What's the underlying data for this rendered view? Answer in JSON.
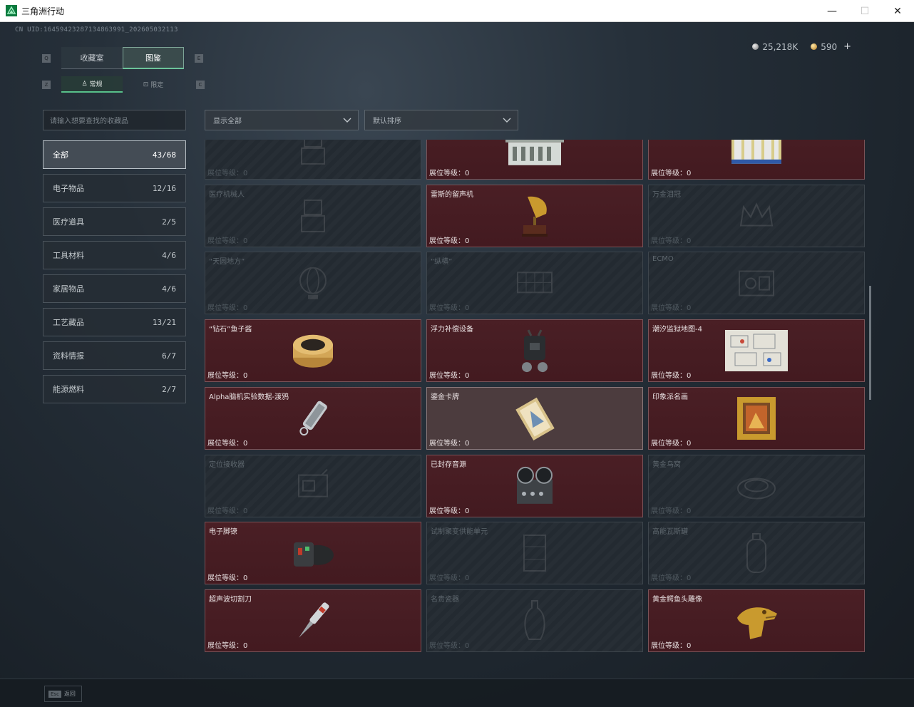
{
  "window": {
    "title": "三角洲行动",
    "minimize": "—",
    "maximize": "☐",
    "close": "✕"
  },
  "uid": "CN UID:16459423287134863991_202605032113",
  "currency": [
    {
      "type": "silver",
      "value": "25,218K"
    },
    {
      "type": "gold",
      "value": "590"
    }
  ],
  "currency_plus": "+",
  "key_hints": {
    "q": "Q",
    "e": "E",
    "z": "Z",
    "c": "C"
  },
  "tabs": [
    {
      "label": "收藏室",
      "active": false
    },
    {
      "label": "图鉴",
      "active": true
    }
  ],
  "subtabs": [
    {
      "label": "常规",
      "icon": "trophy-icon",
      "active": true
    },
    {
      "label": "限定",
      "icon": "box-icon",
      "active": false
    }
  ],
  "search": {
    "placeholder": "请输入想要查找的收藏品"
  },
  "sidebar": [
    {
      "label": "全部",
      "count": "43/68",
      "active": true
    },
    {
      "label": "电子物品",
      "count": "12/16",
      "active": false
    },
    {
      "label": "医疗道具",
      "count": "2/5",
      "active": false
    },
    {
      "label": "工具材料",
      "count": "4/6",
      "active": false
    },
    {
      "label": "家居物品",
      "count": "4/6",
      "active": false
    },
    {
      "label": "工艺藏品",
      "count": "13/21",
      "active": false
    },
    {
      "label": "资料情报",
      "count": "6/7",
      "active": false
    },
    {
      "label": "能源燃料",
      "count": "2/7",
      "active": false
    }
  ],
  "filters": {
    "display": "显示全部",
    "sort": "默认排序"
  },
  "level_label": "展位等级：",
  "cards": [
    {
      "name": "",
      "level": "0",
      "state": "locked",
      "icon": "robot-icon"
    },
    {
      "name": "",
      "level": "0",
      "state": "owned",
      "icon": "server-case-icon"
    },
    {
      "name": "",
      "level": "0",
      "state": "owned",
      "icon": "battery-pack-icon"
    },
    {
      "name": "医疗机械人",
      "level": "0",
      "state": "locked",
      "icon": "robot-icon"
    },
    {
      "name": "雷斯的留声机",
      "level": "0",
      "state": "owned",
      "icon": "gramophone-icon"
    },
    {
      "name": "万金泪冠",
      "level": "0",
      "state": "locked",
      "icon": "crown-icon"
    },
    {
      "name": "“天圆地方”",
      "level": "0",
      "state": "locked",
      "icon": "globe-icon"
    },
    {
      "name": "“纵横”",
      "level": "0",
      "state": "locked",
      "icon": "board-icon"
    },
    {
      "name": "ECMO",
      "level": "0",
      "state": "locked",
      "icon": "machine-icon"
    },
    {
      "name": "“钻石”鱼子酱",
      "level": "0",
      "state": "owned",
      "icon": "caviar-tin-icon"
    },
    {
      "name": "浮力补偿设备",
      "level": "0",
      "state": "owned",
      "icon": "diving-gear-icon"
    },
    {
      "name": "潮汐监狱地图-4",
      "level": "0",
      "state": "owned",
      "icon": "map-icon"
    },
    {
      "name": "Alpha脑机实验数据-渡鸦",
      "level": "0",
      "state": "owned",
      "icon": "usb-drive-icon"
    },
    {
      "name": "鎏金卡牌",
      "level": "0",
      "state": "highlight",
      "icon": "card-icon"
    },
    {
      "name": "印象派名画",
      "level": "0",
      "state": "owned",
      "icon": "painting-icon"
    },
    {
      "name": "定位接收器",
      "level": "0",
      "state": "locked",
      "icon": "receiver-icon"
    },
    {
      "name": "已封存音源",
      "level": "0",
      "state": "owned",
      "icon": "tape-recorder-icon"
    },
    {
      "name": "黄金鸟窝",
      "level": "0",
      "state": "locked",
      "icon": "nest-icon"
    },
    {
      "name": "电子脚镣",
      "level": "0",
      "state": "owned",
      "icon": "ankle-monitor-icon"
    },
    {
      "name": "试制聚变供能单元",
      "level": "0",
      "state": "locked",
      "icon": "fusion-cell-icon"
    },
    {
      "name": "高能瓦斯罐",
      "level": "0",
      "state": "locked",
      "icon": "gas-tank-icon"
    },
    {
      "name": "超声波切割刀",
      "level": "0",
      "state": "owned",
      "icon": "ultrasonic-knife-icon"
    },
    {
      "name": "名贵瓷器",
      "level": "0",
      "state": "locked",
      "icon": "vase-icon"
    },
    {
      "name": "黄金鳄鱼头雕像",
      "level": "0",
      "state": "owned",
      "icon": "gold-crocodile-icon"
    }
  ],
  "esc": {
    "key": "Esc",
    "label": "返回"
  }
}
